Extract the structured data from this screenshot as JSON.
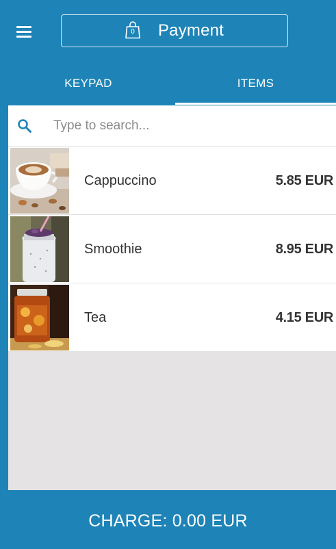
{
  "header": {
    "title": "Payment",
    "cart_count": "0"
  },
  "tabs": [
    {
      "label": "KEYPAD",
      "active": false
    },
    {
      "label": "ITEMS",
      "active": true
    }
  ],
  "search": {
    "placeholder": "Type to search...",
    "value": ""
  },
  "items": [
    {
      "name": "Cappuccino",
      "price": "5.85 EUR",
      "image": "cappuccino-photo"
    },
    {
      "name": "Smoothie",
      "price": "8.95 EUR",
      "image": "smoothie-photo"
    },
    {
      "name": "Tea",
      "price": "4.15 EUR",
      "image": "tea-photo"
    }
  ],
  "charge": {
    "label": "CHARGE: 0.00 EUR"
  },
  "colors": {
    "primary": "#1e84b7",
    "background": "#e5e3e4",
    "text": "#333333"
  }
}
